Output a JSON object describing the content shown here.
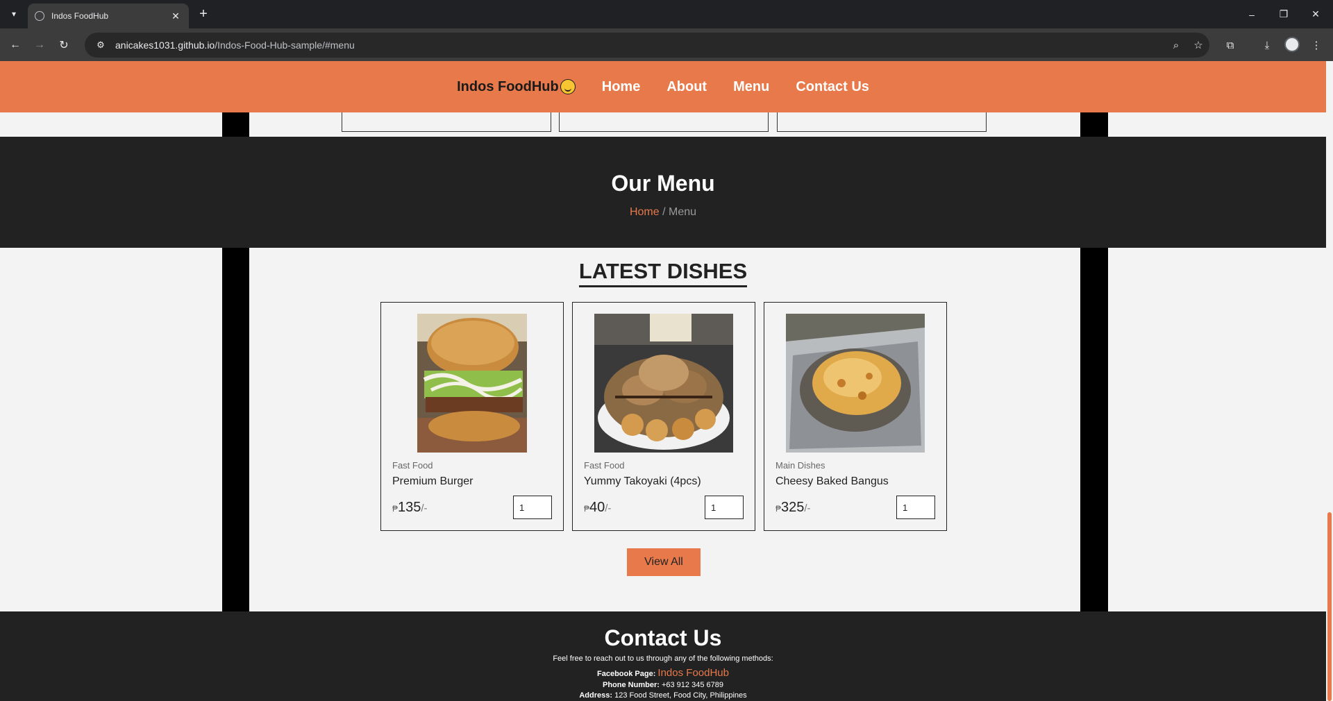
{
  "browser": {
    "tab_title": "Indos FoodHub",
    "url_host": "anicakes1031.github.io",
    "url_path": "/Indos-Food-Hub-sample/#menu"
  },
  "site": {
    "brand": "Indos FoodHub",
    "nav": [
      "Home",
      "About",
      "Menu",
      "Contact Us"
    ]
  },
  "menu_banner": {
    "title": "Our Menu",
    "breadcrumb_home": "Home",
    "breadcrumb_sep": "/",
    "breadcrumb_current": "Menu"
  },
  "latest": {
    "title": "LATEST DISHES",
    "dishes": [
      {
        "category": "Fast Food",
        "name": "Premium Burger",
        "currency": "₱",
        "price": "135",
        "suffix": "/-",
        "qty": "1"
      },
      {
        "category": "Fast Food",
        "name": "Yummy Takoyaki (4pcs)",
        "currency": "₱",
        "price": "40",
        "suffix": "/-",
        "qty": "1"
      },
      {
        "category": "Main Dishes",
        "name": "Cheesy Baked Bangus",
        "currency": "₱",
        "price": "325",
        "suffix": "/-",
        "qty": "1"
      }
    ],
    "view_all": "View All"
  },
  "contact": {
    "title": "Contact Us",
    "intro": "Feel free to reach out to us through any of the following methods:",
    "facebook_label": "Facebook Page:",
    "facebook_value": "Indos FoodHub",
    "phone_label": "Phone Number:",
    "phone_value": "+63 912 345 6789",
    "address_label": "Address:",
    "address_value": "123 Food Street, Food City, Philippines"
  },
  "colors": {
    "accent": "#e8794a",
    "dark": "#222222",
    "page_bg": "#f3f3f3"
  }
}
